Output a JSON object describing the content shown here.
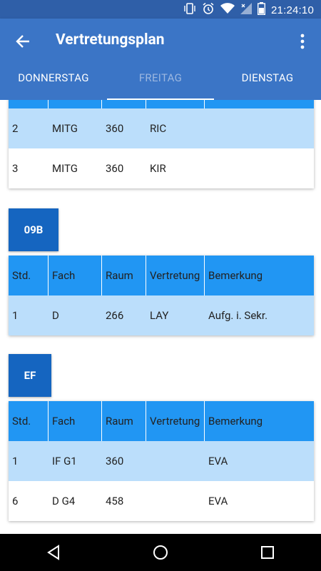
{
  "status": {
    "time": "21:24:10"
  },
  "appbar": {
    "title": "Vertretungsplan"
  },
  "tabs": [
    {
      "label": "DONNERSTAG"
    },
    {
      "label": "FREITAG"
    },
    {
      "label": "DIENSTAG"
    }
  ],
  "columns": [
    "Std.",
    "Fach",
    "Raum",
    "Vertretung",
    "Bemerkung"
  ],
  "group0": {
    "rows": [
      {
        "std": "2",
        "fach": "MITG",
        "raum": "360",
        "vertretung": "RIC",
        "bemerkung": ""
      },
      {
        "std": "3",
        "fach": "MITG",
        "raum": "360",
        "vertretung": "KIR",
        "bemerkung": ""
      }
    ]
  },
  "group1": {
    "name": "09B",
    "rows": [
      {
        "std": "1",
        "fach": "D",
        "raum": "266",
        "vertretung": "LAY",
        "bemerkung": "Aufg. i. Sekr."
      }
    ]
  },
  "group2": {
    "name": "EF",
    "rows": [
      {
        "std": "1",
        "fach": "IF G1",
        "raum": "360",
        "vertretung": "",
        "bemerkung": "EVA"
      },
      {
        "std": "6",
        "fach": "D G4",
        "raum": "458",
        "vertretung": "",
        "bemerkung": "EVA"
      }
    ]
  }
}
